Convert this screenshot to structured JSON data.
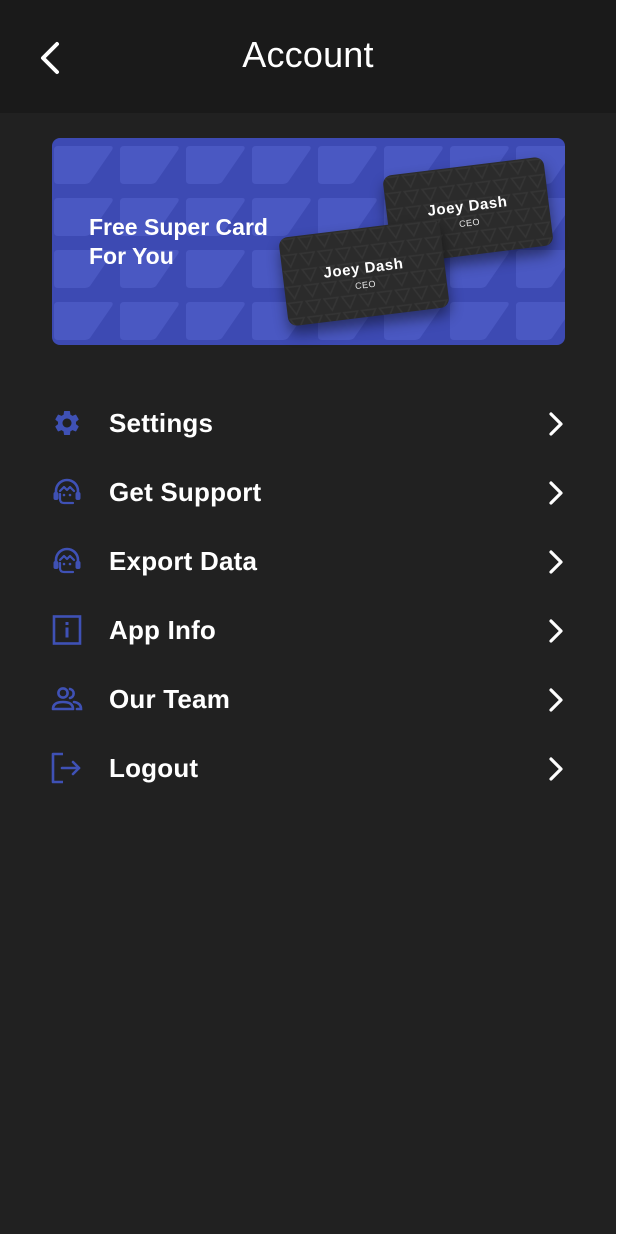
{
  "header": {
    "title": "Account",
    "back_icon": "chevron-left-icon"
  },
  "promo": {
    "line1": "Free Super Card",
    "line2": "For You",
    "background_color": "#3d4ab3",
    "cards": [
      {
        "name": "Joey Dash",
        "role": "CEO"
      },
      {
        "name": "Joey Dash",
        "role": "CEO"
      }
    ]
  },
  "menu": {
    "accent_color": "#3f51b5",
    "items": [
      {
        "label": "Settings",
        "icon": "gear-icon"
      },
      {
        "label": "Get Support",
        "icon": "headset-icon"
      },
      {
        "label": "Export Data",
        "icon": "headset-icon"
      },
      {
        "label": "App Info",
        "icon": "info-icon"
      },
      {
        "label": "Our Team",
        "icon": "people-icon"
      },
      {
        "label": "Logout",
        "icon": "logout-icon"
      }
    ],
    "chevron_icon": "chevron-right-icon"
  }
}
